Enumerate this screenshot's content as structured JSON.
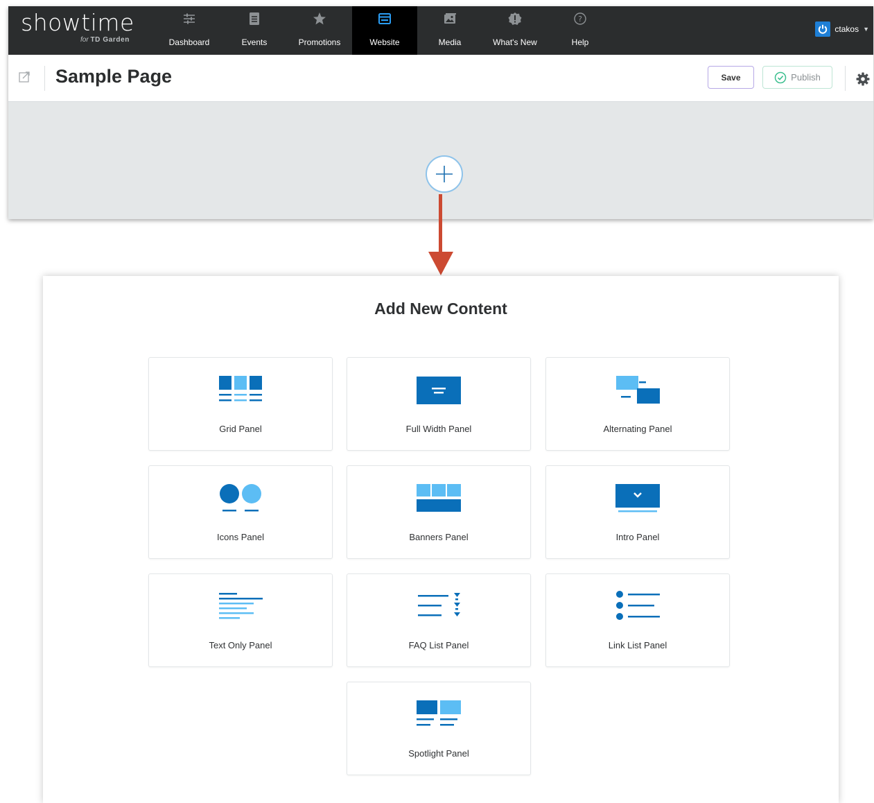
{
  "brand": {
    "name": "showtime",
    "tagline_prefix": "for",
    "tagline_org": "TD Garden"
  },
  "nav": {
    "items": [
      {
        "label": "Dashboard",
        "icon": "sliders-icon"
      },
      {
        "label": "Events",
        "icon": "document-icon"
      },
      {
        "label": "Promotions",
        "icon": "star-icon"
      },
      {
        "label": "Website",
        "icon": "browser-window-icon",
        "active": true
      },
      {
        "label": "Media",
        "icon": "images-icon"
      },
      {
        "label": "What's New",
        "icon": "alert-badge-icon"
      },
      {
        "label": "Help",
        "icon": "question-circle-icon"
      }
    ],
    "user": "ctakos"
  },
  "page": {
    "title": "Sample Page",
    "save_label": "Save",
    "publish_label": "Publish"
  },
  "modal": {
    "title": "Add New Content",
    "cards": [
      {
        "label": "Grid Panel",
        "icon": "grid-panel-icon"
      },
      {
        "label": "Full Width Panel",
        "icon": "full-width-panel-icon"
      },
      {
        "label": "Alternating Panel",
        "icon": "alternating-panel-icon"
      },
      {
        "label": "Icons Panel",
        "icon": "icons-panel-icon"
      },
      {
        "label": "Banners Panel",
        "icon": "banners-panel-icon"
      },
      {
        "label": "Intro Panel",
        "icon": "intro-panel-icon"
      },
      {
        "label": "Text Only Panel",
        "icon": "text-only-panel-icon"
      },
      {
        "label": "FAQ List Panel",
        "icon": "faq-list-panel-icon"
      },
      {
        "label": "Link List Panel",
        "icon": "link-list-panel-icon"
      },
      {
        "label": "Spotlight Panel",
        "icon": "spotlight-panel-icon"
      }
    ]
  },
  "colors": {
    "nav_bg": "#2b2d2e",
    "accent_dark_blue": "#0a6fb9",
    "accent_light_blue": "#5cbdf4",
    "arrow_red": "#cc4a32"
  }
}
